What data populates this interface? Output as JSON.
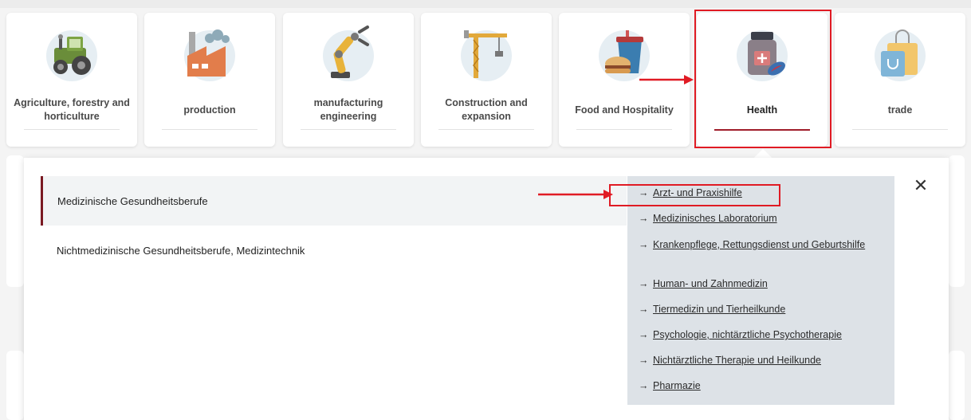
{
  "sectors": [
    {
      "label": "Agriculture, forestry and horticulture",
      "icon": "tractor-icon"
    },
    {
      "label": "production",
      "icon": "factory-icon"
    },
    {
      "label": "manufacturing engineering",
      "icon": "robot-arm-icon"
    },
    {
      "label": "Construction and expansion",
      "icon": "crane-icon"
    },
    {
      "label": "Food and Hospitality",
      "icon": "food-icon"
    },
    {
      "label": "Health",
      "icon": "medicine-bottle-icon",
      "selected": true
    },
    {
      "label": "trade",
      "icon": "shopping-bag-icon"
    }
  ],
  "panel": {
    "subcategories": [
      {
        "label": "Medizinische Gesundheitsberufe",
        "active": true
      },
      {
        "label": "Nichtmedizinische Gesundheitsberufe, Medizintechnik",
        "active": false
      }
    ],
    "arrow_glyph": "→",
    "occupations": [
      "Arzt- und Praxishilfe",
      "Medizinisches Laboratorium",
      "Krankenpflege, Rettungsdienst und Geburtshilfe",
      "Human- und Zahnmedizin",
      "Tiermedizin und Tierheilkunde",
      "Psychologie, nichtärztliche Psychotherapie",
      "Nichtärztliche Therapie und Heilkunde",
      "Pharmazie"
    ],
    "close_glyph": "✕"
  },
  "colors": {
    "accent": "#a01d2a",
    "highlight": "#e01b24",
    "list_bg": "#dde2e7",
    "icon_circle": "#e6eef3"
  }
}
